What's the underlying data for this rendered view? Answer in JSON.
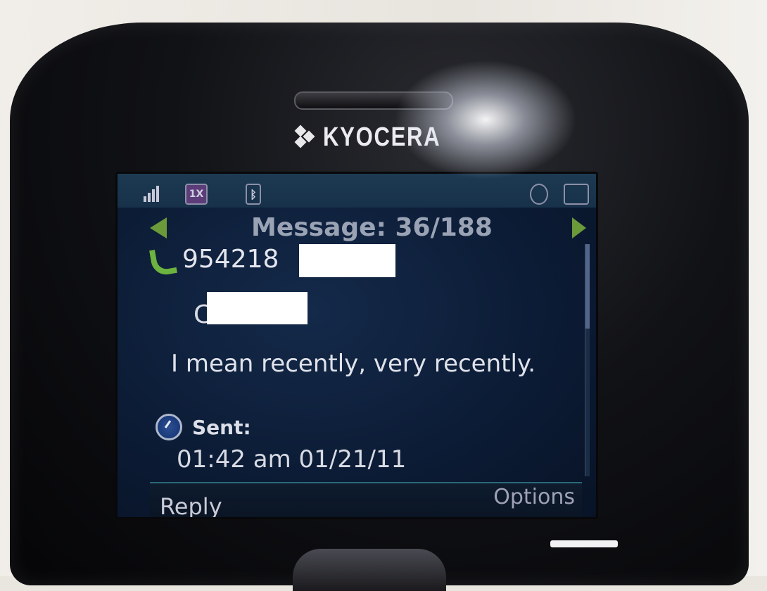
{
  "device": {
    "brand": "KYOCERA"
  },
  "status_bar": {
    "network_badge": "1X",
    "icons": [
      "signal-icon",
      "1x-network-icon",
      "bluetooth-icon",
      "clock-icon",
      "battery-icon"
    ]
  },
  "header": {
    "title": "Message: 36/188"
  },
  "message": {
    "sender_number_visible": "954218",
    "contact_initial": "C",
    "body": "I mean recently, very recently.",
    "sent_label": "Sent:",
    "timestamp": "01:42 am 01/21/11"
  },
  "softkeys": {
    "left": "Reply",
    "right": "Options"
  },
  "colors": {
    "screen_bg": "#0c1c36",
    "arrow_green": "#6a9a3a",
    "phone_icon_green": "#6db33f",
    "redaction": "#ffffff"
  }
}
